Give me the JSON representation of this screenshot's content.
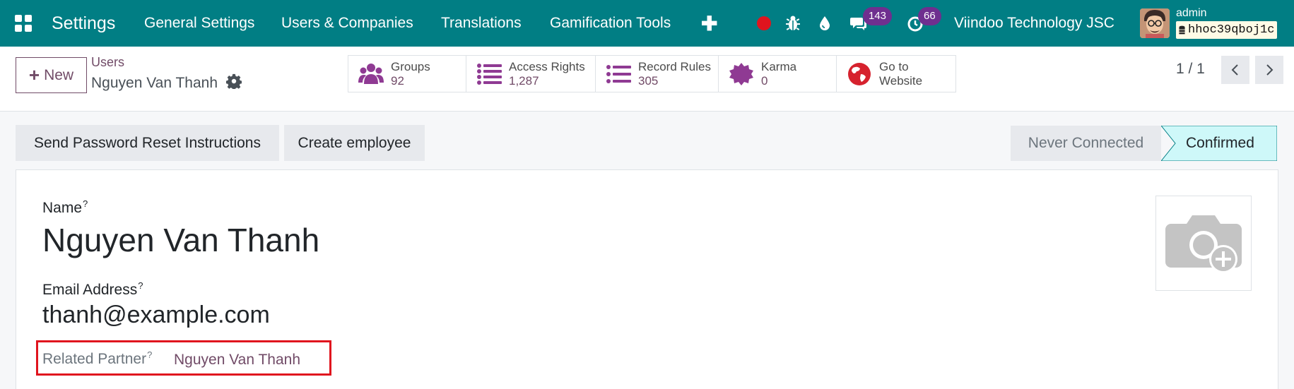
{
  "navbar": {
    "brand": "Settings",
    "menu": [
      "General Settings",
      "Users & Companies",
      "Translations",
      "Gamification Tools"
    ],
    "messages_count": "143",
    "activities_count": "66",
    "company": "Viindoo Technology JSC",
    "user": "admin",
    "database": "hhoc39qboj1c",
    "colors": {
      "bar": "#017e84",
      "badge": "#6f2f8f",
      "recording_dot": "#e0141e"
    }
  },
  "control": {
    "new_label": "New",
    "breadcrumb": "Users",
    "record_name": "Nguyen Van Thanh",
    "smart_buttons": [
      {
        "label": "Groups",
        "value": "92",
        "icon": "users-icon"
      },
      {
        "label": "Access Rights",
        "value": "1,287",
        "icon": "list-icon"
      },
      {
        "label": "Record Rules",
        "value": "305",
        "icon": "list-icon"
      },
      {
        "label": "Karma",
        "value": "0",
        "icon": "badge-icon"
      },
      {
        "label": "Go to",
        "value": "Website",
        "icon": "globe-icon"
      }
    ],
    "pager": "1 / 1"
  },
  "statusbar": {
    "actions": [
      "Send Password Reset Instructions",
      "Create employee"
    ],
    "stages": [
      "Never Connected",
      "Confirmed"
    ],
    "active_stage": "Confirmed"
  },
  "form": {
    "name_label": "Name",
    "name_value": "Nguyen Van Thanh",
    "email_label": "Email Address",
    "email_value": "thanh@example.com",
    "partner_label": "Related Partner",
    "partner_value": "Nguyen Van Thanh",
    "help_mark": "?"
  },
  "accent": "#714b67"
}
